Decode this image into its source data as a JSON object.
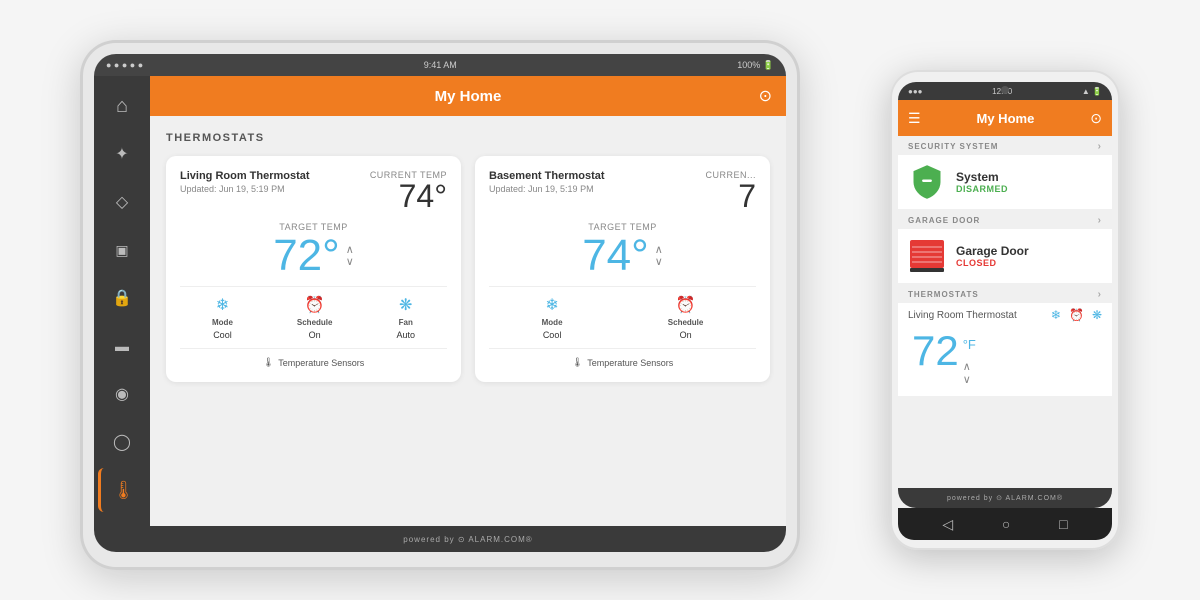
{
  "colors": {
    "orange": "#f07c20",
    "sidebar_bg": "#3a3a3a",
    "blue_temp": "#4db6e4",
    "white": "#ffffff",
    "light_bg": "#f0f0f0"
  },
  "tablet": {
    "statusbar": {
      "dots": "● ● ● ● ●",
      "time": "9:41 AM",
      "battery": "100% 🔋"
    },
    "header": {
      "title": "My Home",
      "icon": "⊙"
    },
    "footer": "powered by ⊙ ALARM.COM®",
    "section_title": "THERMOSTATS",
    "sidebar": {
      "items": [
        {
          "icon": "⌂",
          "label": "home",
          "active": false
        },
        {
          "icon": "☀",
          "label": "lighting",
          "active": false
        },
        {
          "icon": "◇",
          "label": "security",
          "active": false
        },
        {
          "icon": "▣",
          "label": "media",
          "active": false
        },
        {
          "icon": "🔒",
          "label": "locks",
          "active": false
        },
        {
          "icon": "⬛",
          "label": "garage",
          "active": false
        },
        {
          "icon": "◉",
          "label": "camera",
          "active": false
        },
        {
          "icon": "◯",
          "label": "energy",
          "active": false
        },
        {
          "icon": "🌡",
          "label": "thermostats",
          "active": true
        }
      ]
    },
    "thermostats": [
      {
        "name": "Living Room Thermostat",
        "updated": "Updated: Jun 19, 5:19 PM",
        "current_label": "CURRENT TEMP",
        "current_temp": "74°",
        "target_label": "TARGET TEMP",
        "target_temp": "72°",
        "mode_label": "Mode",
        "mode_value": "Cool",
        "schedule_label": "Schedule",
        "schedule_value": "On",
        "fan_label": "Fan",
        "fan_value": "Auto",
        "sensors_label": "Temperature Sensors"
      },
      {
        "name": "Basement Thermostat",
        "updated": "Updated: Jun 19, 5:19 PM",
        "current_label": "CURRENT TEMP",
        "current_temp": "7",
        "target_label": "TARGET TEMP",
        "target_temp": "74°",
        "mode_label": "Mode",
        "mode_value": "Cool",
        "schedule_label": "Schedule",
        "schedule_value": "On",
        "sensors_label": "Temperature Sensors"
      }
    ]
  },
  "phone": {
    "statusbar": {
      "left": "●●●",
      "time": "12:30",
      "right": "▲ 🔋"
    },
    "header": {
      "menu_icon": "☰",
      "title": "My Home",
      "settings_icon": "⊙"
    },
    "sections": {
      "security": {
        "title": "SECURITY SYSTEM",
        "device_name": "System",
        "device_status": "DISARMED"
      },
      "garage": {
        "title": "GARAGE DOOR",
        "device_name": "Garage Door",
        "device_status": "CLOSED"
      },
      "thermostat": {
        "title": "THERMOSTATS",
        "device_name": "Living Room Thermostat",
        "target_temp": "72",
        "unit": "°F"
      }
    },
    "footer": "powered by ⊙ ALARM.COM®"
  }
}
